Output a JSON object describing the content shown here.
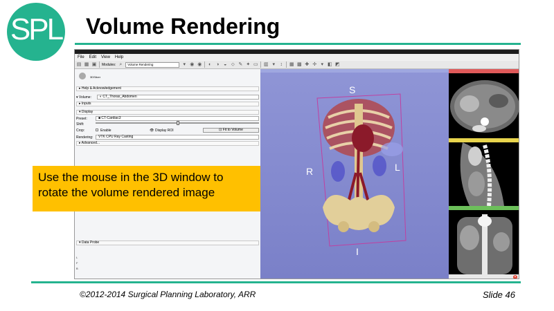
{
  "slide": {
    "logo_text": "SPL",
    "title": "Volume Rendering",
    "footer_copyright": "©2012-2014 Surgical Planning Laboratory, ARR",
    "footer_slide": "Slide 46",
    "brand_color": "#25b38f"
  },
  "callout": {
    "text": "Use the mouse in the 3D window to rotate the volume rendered image",
    "color": "#ffc000"
  },
  "app": {
    "menu": [
      "File",
      "Edit",
      "View",
      "Help"
    ],
    "toolbar": {
      "modules_label": "Modules:",
      "module_selected": "Volume Rendering"
    },
    "panel": {
      "logo_label": "3DSlicer",
      "help_section": "Help & Acknowledgement",
      "volume_label": "Volume:",
      "volume_value": "CT_Thorax_Abdomen",
      "inputs_section": "Inputs",
      "display_section": "Display",
      "preset_label": "Preset:",
      "preset_value": "CT-Cardiac3",
      "shift_label": "Shift:",
      "crop_label": "Crop:",
      "enable_label": "Enable",
      "display_roi_label": "Display ROI",
      "fit_button": "Fit to Volume",
      "rendering_label": "Rendering:",
      "rendering_value": "VTK CPU Ray Casting",
      "advanced_section": "Advanced...",
      "data_probe_section": "Data Probe",
      "probe_lines": [
        "L",
        "F",
        "B"
      ]
    },
    "view3d": {
      "orientation": {
        "top": "S",
        "left": "R",
        "right": "L",
        "bottom": "I"
      }
    },
    "slices": [
      {
        "name": "red",
        "color": "#e05a5a"
      },
      {
        "name": "yellow",
        "color": "#e8d44d"
      },
      {
        "name": "green",
        "color": "#6cbf5a"
      }
    ]
  }
}
